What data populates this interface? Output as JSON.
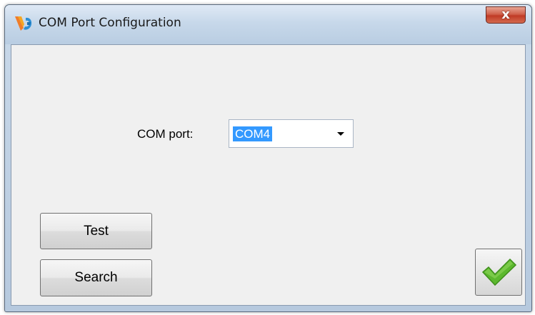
{
  "window": {
    "title": "COM Port Configuration",
    "close_label": "x"
  },
  "form": {
    "com_port_label": "COM port:",
    "com_port_value": "COM4"
  },
  "buttons": {
    "test_label": "Test",
    "search_label": "Search"
  },
  "icons": {
    "app": "app-logo-icon",
    "close": "close-icon",
    "dropdown": "chevron-down-icon",
    "ok": "checkmark-icon"
  },
  "colors": {
    "selection": "#3399ff",
    "checkmark": "#5cb82e"
  }
}
